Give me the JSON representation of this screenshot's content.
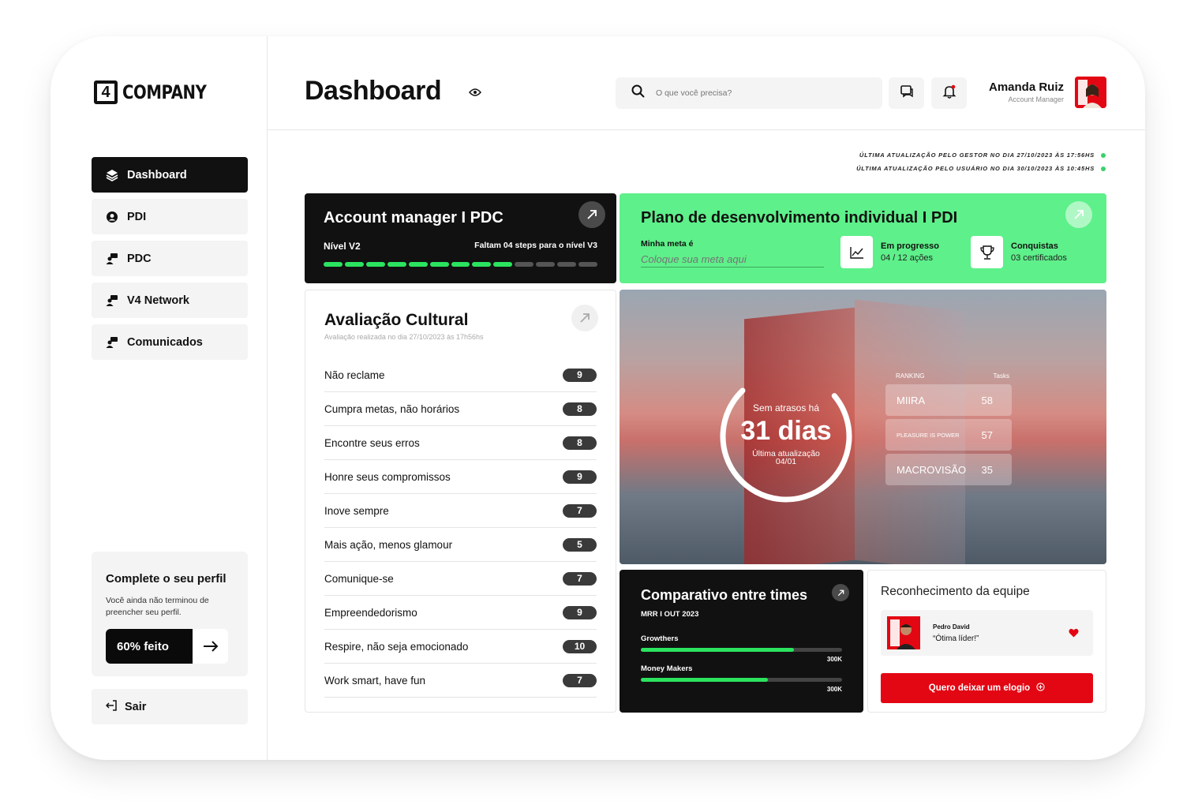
{
  "brand": {
    "logo_mark": "4",
    "logo_text": "COMPANY"
  },
  "nav": [
    {
      "label": "Dashboard",
      "icon": "layers-icon",
      "active": true
    },
    {
      "label": "PDI",
      "icon": "user-circle-icon"
    },
    {
      "label": "PDC",
      "icon": "people-icon"
    },
    {
      "label": "V4 Network",
      "icon": "people-icon"
    },
    {
      "label": "Comunicados",
      "icon": "people-icon"
    }
  ],
  "profile_card": {
    "title": "Complete o seu perfil",
    "text": "Você ainda não terminou de preencher seu perfil.",
    "progress_label": "60% feito",
    "progress": 0.6
  },
  "logout": {
    "label": "Sair"
  },
  "header": {
    "title": "Dashboard",
    "search_placeholder": "O que você precisa?",
    "user_name": "Amanda Ruiz",
    "user_role": "Account Manager"
  },
  "updates": [
    "ÚLTIMA ATUALIZAÇÃO PELO GESTOR NO DIA 27/10/2023 ÀS 17:56HS",
    "ÚLTIMA ATUALIZAÇÃO PELO USUÁRIO NO DIA 30/10/2023 ÀS 10:45HS"
  ],
  "pdc": {
    "title": "Account manager I PDC",
    "level": "Nível V2",
    "remaining": "Faltam 04 steps para o nível V3",
    "steps_total": 13,
    "steps_done": 9
  },
  "pdi": {
    "title": "Plano de desenvolvimento individual I PDI",
    "goal_label": "Minha meta é",
    "goal_placeholder": "Coloque sua meta aqui",
    "progress_title": "Em progresso",
    "progress_value": "04 / 12 ações",
    "achievements_title": "Conquistas",
    "achievements_value": "03 certificados"
  },
  "culture": {
    "title": "Avaliação Cultural",
    "subtitle": "Avaliação realizada no dia 27/10/2023 às 17h56hs",
    "items": [
      {
        "label": "Não reclame",
        "score": "9"
      },
      {
        "label": "Cumpra metas, não horários",
        "score": "8"
      },
      {
        "label": "Encontre seus erros",
        "score": "8"
      },
      {
        "label": "Honre seus compromissos",
        "score": "9"
      },
      {
        "label": "Inove sempre",
        "score": "7"
      },
      {
        "label": "Mais ação, menos glamour",
        "score": "5"
      },
      {
        "label": "Comunique-se",
        "score": "7"
      },
      {
        "label": "Empreendedorismo",
        "score": "9"
      },
      {
        "label": "Respire, não seja emocionado",
        "score": "10"
      },
      {
        "label": "Work smart, have fun",
        "score": "7"
      }
    ]
  },
  "hero": {
    "streak_label": "Sem atrasos há",
    "streak_value": "31 dias",
    "update_label": "Última atualização",
    "update_date": "04/01",
    "ranking_header": "RANKING",
    "tasks_header": "Tasks",
    "ranking": [
      {
        "name": "MIIRA",
        "tasks": "58"
      },
      {
        "name": "PLEASURE IS POWER",
        "tasks": "57"
      },
      {
        "name": "MACROVISÃO",
        "tasks": "35"
      }
    ]
  },
  "compare": {
    "title": "Comparativo entre times",
    "subtitle": "MRR I OUT 2023",
    "teams": [
      {
        "name": "Growthers",
        "max": "300K",
        "fill": 0.76
      },
      {
        "name": "Money Makers",
        "max": "300K",
        "fill": 0.63
      }
    ]
  },
  "recognition": {
    "title": "Reconhecimento da equipe",
    "person": "Pedro David",
    "message": "“Ótima líder!”",
    "button": "Quero deixar um elogio"
  },
  "colors": {
    "accent_green": "#5ef08a",
    "progress_green": "#2be35f",
    "brand_red": "#e30613",
    "dark": "#111111"
  }
}
